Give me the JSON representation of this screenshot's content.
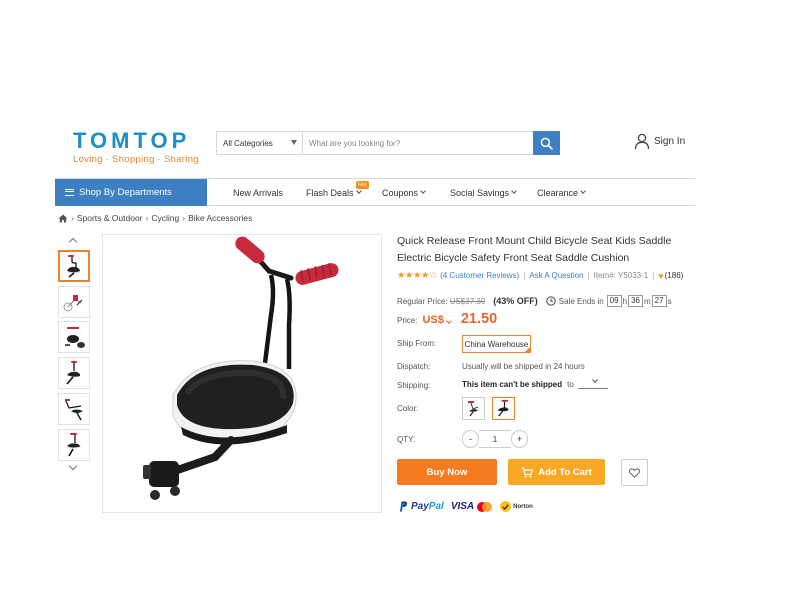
{
  "header": {
    "logo_main": "TOMTOP",
    "logo_sub": "Loving · Shopping · Sharing",
    "search_category": "All Categories",
    "search_placeholder": "What are you looking for?",
    "signin": "Sign In"
  },
  "nav": {
    "dept": "Shop By Departments",
    "items": [
      "New Arrivals",
      "Flash Deals",
      "Coupons",
      "Social Savings",
      "Clearance"
    ],
    "hot_badge": "Hot"
  },
  "breadcrumb": [
    "Sports & Outdoor",
    "Cycling",
    "Bike Accessories"
  ],
  "product": {
    "title": "Quick Release Front Mount Child Bicycle Seat Kids Saddle Electric Bicycle Safety Front Seat Saddle Cushion",
    "rating_stars": 4.5,
    "reviews": "(4 Customer Reviews)",
    "ask": "Ask A Question",
    "item_no": "Item#: Y5033-1",
    "likes": "(186)",
    "regular_label": "Regular Price:",
    "regular_price": "US$37.30",
    "discount": "(43% OFF)",
    "sale_ends_label": "Sale Ends in",
    "timer": {
      "h": "09",
      "m": "36",
      "s": "27",
      "h_unit": "h",
      "m_unit": "m",
      "s_unit": "s"
    },
    "price_label": "Price:",
    "currency": "US$",
    "price": "21.50",
    "ship_from_label": "Ship From:",
    "ship_from": "China Warehouse",
    "dispatch_label": "Dispatch:",
    "dispatch": "Usually will be shipped in 24 hours",
    "shipping_label": "Shipping:",
    "shipping": "This item can't be shipped",
    "shipping_to": "to",
    "color_label": "Color:",
    "qty_label": "QTY:",
    "qty": "1",
    "qty_minus": "-",
    "qty_plus": "+",
    "buy_now": "Buy Now",
    "add_to_cart": "Add To Cart"
  },
  "payments": {
    "paypal_a": "Pay",
    "paypal_b": "Pal",
    "visa": "VISA",
    "norton": "Norton"
  },
  "colors": {
    "brand_blue": "#3d7fc1",
    "logo_blue": "#1e8fc8",
    "accent_orange": "#e8842b",
    "buy_orange": "#f57b20",
    "cart_yellow": "#f9a825",
    "price_orange": "#e8642b"
  }
}
